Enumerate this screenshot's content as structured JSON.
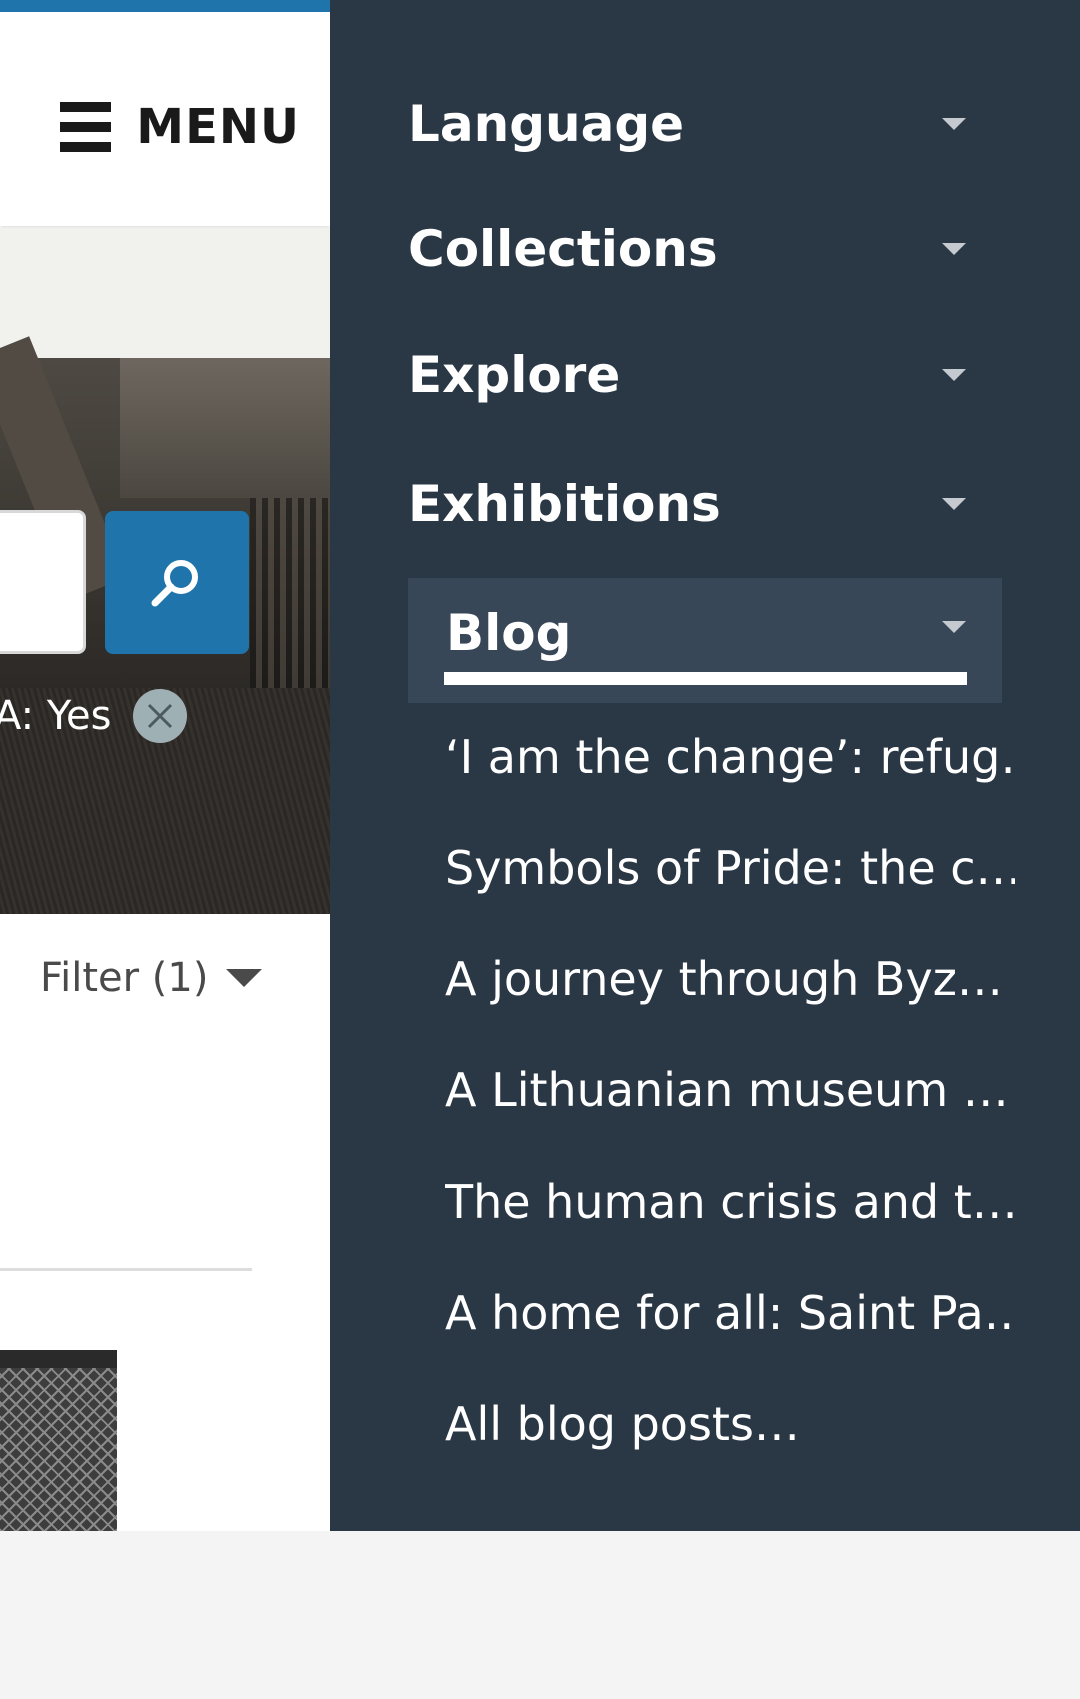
{
  "header": {
    "menu_label": "MENU"
  },
  "search": {
    "filter_chip_text": "A: Yes"
  },
  "results": {
    "filter_label": "Filter (1)"
  },
  "side_menu": {
    "items": [
      {
        "label": "Language"
      },
      {
        "label": "Collections"
      },
      {
        "label": "Explore"
      },
      {
        "label": "Exhibitions"
      },
      {
        "label": "Blog"
      }
    ],
    "blog_posts": [
      {
        "label": "‘I am the change’: refug…"
      },
      {
        "label": "Symbols of Pride: the c…"
      },
      {
        "label": "A journey through Byz…"
      },
      {
        "label": "A Lithuanian museum …"
      },
      {
        "label": "The human crisis and t…"
      },
      {
        "label": "A home for all: Saint Pa…"
      },
      {
        "label": "All blog posts…"
      }
    ]
  },
  "colors": {
    "accent": "#1f75ab",
    "menu_background": "#2a3745",
    "active_item_background": "#374757"
  }
}
